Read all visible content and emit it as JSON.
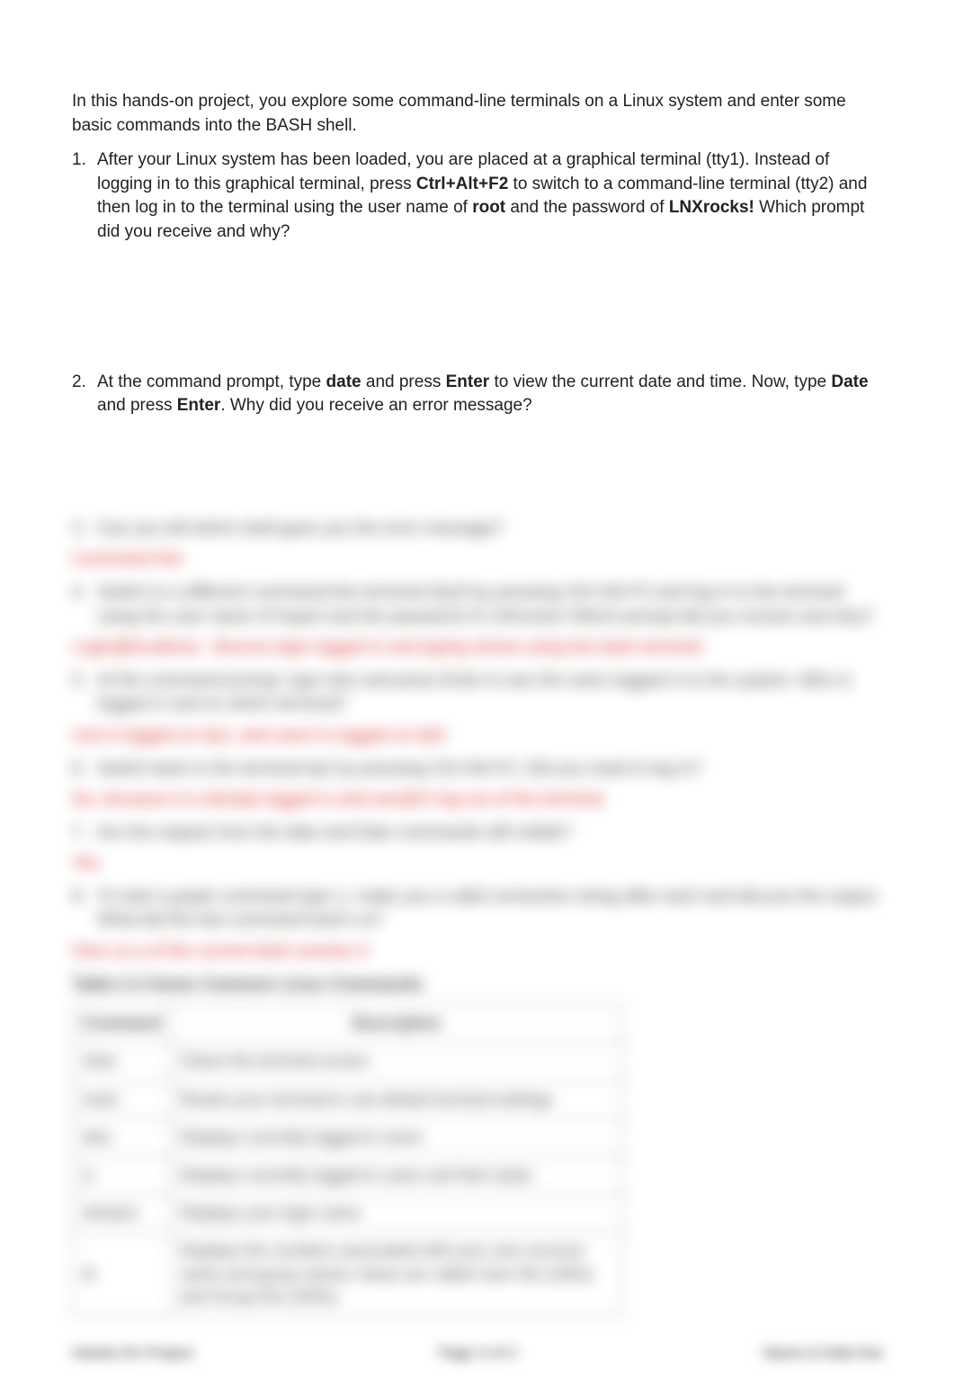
{
  "intro": "In this hands-on project, you explore some command-line terminals on a Linux system and enter some basic commands into the BASH shell.",
  "q1": {
    "number": "1.",
    "parts": [
      {
        "text": "After your Linux system has been loaded, you are placed at a graphical terminal (tty1). Instead of logging in to this graphical terminal, press ",
        "bold": false
      },
      {
        "text": "Ctrl+Alt+F2",
        "bold": true
      },
      {
        "text": " to switch to a command-line terminal (tty2) and then log in to the terminal using the user name of ",
        "bold": false
      },
      {
        "text": "root",
        "bold": true
      },
      {
        "text": " and the password of ",
        "bold": false
      },
      {
        "text": "LNXrocks!",
        "bold": true
      },
      {
        "text": " Which prompt did you receive and why?",
        "bold": false
      }
    ]
  },
  "q2": {
    "number": "2.",
    "parts": [
      {
        "text": "At the command prompt, type ",
        "bold": false
      },
      {
        "text": "date",
        "bold": true
      },
      {
        "text": " and press ",
        "bold": false
      },
      {
        "text": "Enter",
        "bold": true
      },
      {
        "text": " to view the current date and time. Now, type ",
        "bold": false
      },
      {
        "text": "Date",
        "bold": true
      },
      {
        "text": " and press ",
        "bold": false
      },
      {
        "text": "Enter",
        "bold": true
      },
      {
        "text": ". Why did you receive an error message?",
        "bold": false
      }
    ]
  },
  "blurred": {
    "q3": {
      "number": "3.",
      "text": "Can you tell which shell gave you the error message?"
    },
    "a3": "Command Not",
    "q4": {
      "number": "4.",
      "text": "Switch to a different command-line terminal (tty3) by pressing Ctrl+Alt+F3 and log in to the terminal using the user name of hoperl and the password of LNXrocks! Which prompt did you receive and why?"
    },
    "a4": "Login@localhost - Bourne login logged in and typing shows using the bash terminal",
    "q5": {
      "number": "5.",
      "text": "At the command prompt, type who and press Enter to see the users logged in to the system. Who is logged in and on which terminal?"
    },
    "a5": "root is logged on tty2, and user2 is logged on tty5",
    "q6": {
      "number": "6.",
      "text": "Switch back to the terminal tty2 by pressing Ctrl+Alt+F2. Did you need to log in?"
    },
    "a6": "No, because it is already logged in and wouldn't log out of the terminal.",
    "q7": {
      "number": "7.",
      "text": "Are the outputs from the date and Date commands still visible?"
    },
    "a7": "Yes",
    "q8": {
      "number": "8.",
      "text": "To start a graph command type 1, make you a valid connection string after each and discuss the output. What did the last command teach us?"
    },
    "a8": "Give us a of the current bash session #.",
    "table_title": "Table 2-4 Some Common Linux Commands",
    "table_header": {
      "col1": "Command",
      "col2": "Description"
    },
    "table_rows": [
      {
        "cmd": "clear",
        "desc": "Clears the terminal screen"
      },
      {
        "cmd": "reset",
        "desc": "Resets your terminal to use default terminal settings"
      },
      {
        "cmd": "who",
        "desc": "Displays currently logged-in users"
      },
      {
        "cmd": "w",
        "desc": "Displays currently logged-in users and their tasks"
      },
      {
        "cmd": "whoami",
        "desc": "Displays your login name"
      },
      {
        "cmd": "id",
        "desc": "Displays the numbers associated with your user account name and group names; these are called User IDs (UIDs) and Group IDs (GIDs)"
      }
    ]
  },
  "footer": {
    "left": "Hands-On Project",
    "center": "Page 3 of 4",
    "right": "Name & Date line"
  }
}
